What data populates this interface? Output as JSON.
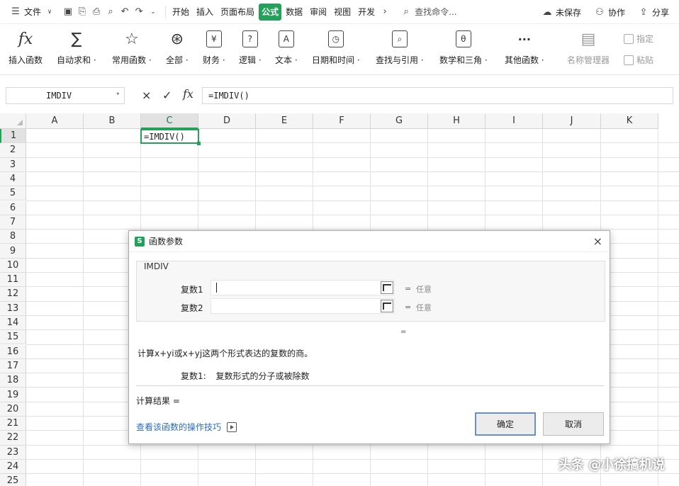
{
  "menubar": {
    "file_label": "文件",
    "tabs": [
      "开始",
      "插入",
      "页面布局",
      "公式",
      "数据",
      "审阅",
      "视图",
      "开发"
    ],
    "active_tab": "公式",
    "more_glyph": "›",
    "search_placeholder": "查找命令...",
    "unsaved_label": "未保存",
    "collab_label": "协作",
    "share_label": "分享"
  },
  "ribbon": {
    "buttons": [
      {
        "label": "插入函数",
        "icon": "function-icon",
        "glyph": "fx"
      },
      {
        "label": "自动求和 ·",
        "icon": "sigma-icon",
        "glyph": "∑"
      },
      {
        "label": "常用函数 ·",
        "icon": "star-icon",
        "glyph": "☆"
      },
      {
        "label": "全部 ·",
        "icon": "asterisk-icon",
        "glyph": "⊛"
      },
      {
        "label": "财务 ·",
        "icon": "finance-icon",
        "glyph": "¥"
      },
      {
        "label": "逻辑 ·",
        "icon": "logic-icon",
        "glyph": "?"
      },
      {
        "label": "文本 ·",
        "icon": "text-icon",
        "glyph": "A"
      },
      {
        "label": "日期和时间 ·",
        "icon": "clock-icon",
        "glyph": "◷"
      },
      {
        "label": "查找与引用 ·",
        "icon": "lookup-icon",
        "glyph": "⌕"
      },
      {
        "label": "数学和三角 ·",
        "icon": "math-icon",
        "glyph": "θ"
      },
      {
        "label": "其他函数 ·",
        "icon": "more-icon",
        "glyph": "···"
      },
      {
        "label": "名称管理器",
        "icon": "name-manager-icon",
        "glyph": "▤"
      }
    ],
    "small_define": "指定",
    "small_paste": "粘贴"
  },
  "formula_bar": {
    "name_box": "IMDIV",
    "cancel_glyph": "×",
    "confirm_glyph": "✓",
    "fx_label": "fx",
    "formula": "=IMDIV()"
  },
  "grid": {
    "columns": [
      "A",
      "B",
      "C",
      "D",
      "E",
      "F",
      "G",
      "H",
      "I",
      "J",
      "K"
    ],
    "rows": [
      "1",
      "2",
      "3",
      "4",
      "5",
      "6",
      "7",
      "8",
      "9",
      "10",
      "11",
      "12",
      "13",
      "14",
      "15",
      "16",
      "17",
      "18",
      "19",
      "20",
      "21",
      "22",
      "23",
      "24",
      "25"
    ],
    "selected_column": "C",
    "selected_row": "1",
    "active_cell_value": "=IMDIV()"
  },
  "dialog": {
    "title": "函数参数",
    "logo_glyph": "S",
    "close_glyph": "×",
    "function_name": "IMDIV",
    "arg1_label": "复数1",
    "arg1_value": "",
    "arg1_eq": "=",
    "arg1_type": "任意",
    "arg2_label": "复数2",
    "arg2_value": "",
    "arg2_eq": "=",
    "arg2_type": "任意",
    "dot_glyph": "=",
    "description": "计算x+yi或x+yj这两个形式表达的复数的商。",
    "arg_help_key": "复数1:",
    "arg_help_text": "复数形式的分子或被除数",
    "result_label": "计算结果 =",
    "tip_link": "查看该函数的操作技巧",
    "ok_label": "确定",
    "cancel_label": "取消"
  },
  "watermark": "头条 @小徐搞机说"
}
